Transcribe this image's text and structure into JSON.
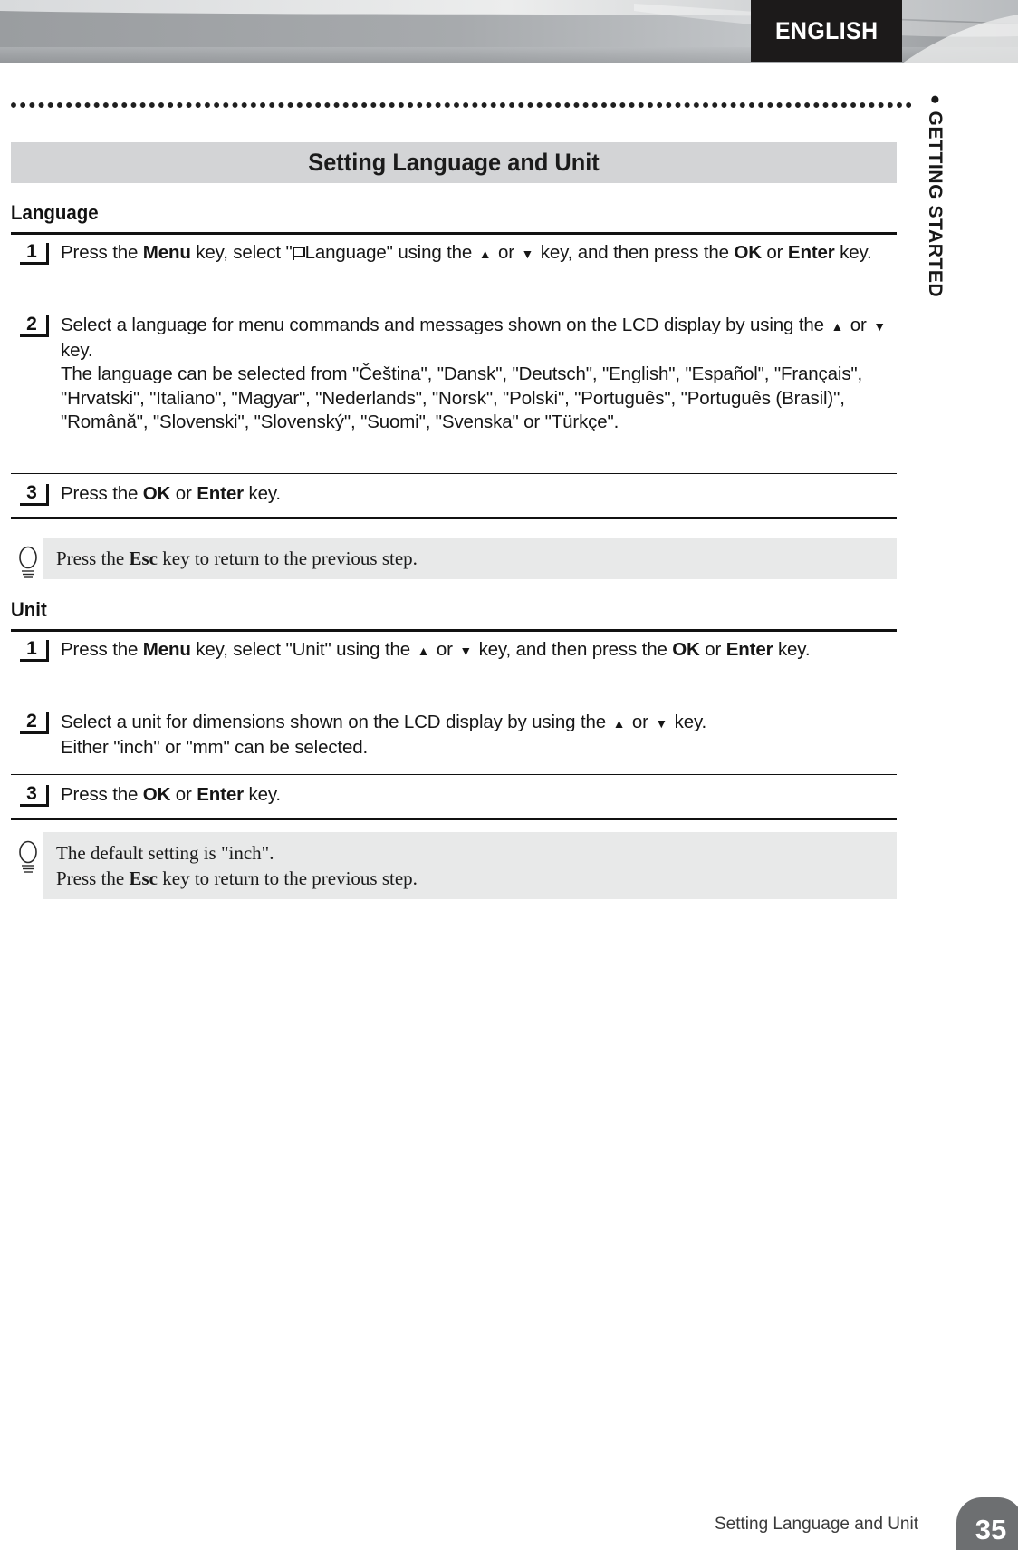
{
  "header": {
    "language_tab": "ENGLISH",
    "side_tab_bullet": "●",
    "side_tab_label": "GETTING STARTED"
  },
  "title_bar": {
    "title": "Setting Language and Unit"
  },
  "sections": [
    {
      "heading": "Language",
      "steps": [
        {
          "number": "1",
          "text_html": "Press the <b>Menu</b> key, select \"<span class=\"flag-glyph\" data-name=\"language-flag-icon\" data-interactable=\"false\"></span>Language\" using the <span class=\"arr arrow-up\"></span> or <span class=\"arr arrow-down\"></span> key, and then press the <b>OK</b> or <b>Enter</b> key."
        },
        {
          "number": "2",
          "text_html": "Select a language for menu commands and messages shown on the LCD display by using the <span class=\"arr arrow-up\"></span> or <span class=\"arr arrow-down\"></span> key.<br>The language can be selected from \"&#268;e&#353;tina\", \"Dansk\", \"Deutsch\", \"English\", \"Espa&ntilde;ol\", \"Fran&ccedil;ais\", \"Hrvatski\", \"Italiano\", \"Magyar\", \"Nederlands\", \"Norsk\", \"Polski\", \"Portugu&ecirc;s\", \"Portugu&ecirc;s (Brasil)\", \"Rom&acirc;n&#259;\", \"Slovenski\", \"Slovensk&yacute;\", \"Suomi\", \"Svenska\" or \"T&uuml;rk&ccedil;e\"."
        },
        {
          "number": "3",
          "text_html": "Press the <b>OK</b> or <b>Enter</b> key."
        }
      ],
      "tip": {
        "text_html": "Press the <b>Esc</b> key to return to the previous step."
      }
    },
    {
      "heading": "Unit",
      "steps": [
        {
          "number": "1",
          "text_html": "Press the <b>Menu</b> key, select \"Unit\" using the <span class=\"arr arrow-up\"></span> or <span class=\"arr arrow-down\"></span> key, and then press the <b>OK</b> or <b>Enter</b> key."
        },
        {
          "number": "2",
          "text_html": "Select a unit for dimensions shown on the LCD display by using the <span class=\"arr arrow-up\"></span> or <span class=\"arr arrow-down\"></span> key.<br>Either \"inch\" or \"mm\" can be selected."
        },
        {
          "number": "3",
          "text_html": "Press the <b>OK</b> or <b>Enter</b> key."
        }
      ],
      "tip": {
        "text_html": "The default setting is \"inch\".<br>Press the <b>Esc</b> key to return to the previous step."
      }
    }
  ],
  "footer": {
    "running_title": "Setting Language and Unit",
    "page_number": "35"
  },
  "colors": {
    "title_bar_bg": "#d3d4d6",
    "tip_bg": "#e8e9e9",
    "tab_bg": "#1c1a1a",
    "page_tab_bg": "#6d6f71",
    "rule": "#111111"
  }
}
